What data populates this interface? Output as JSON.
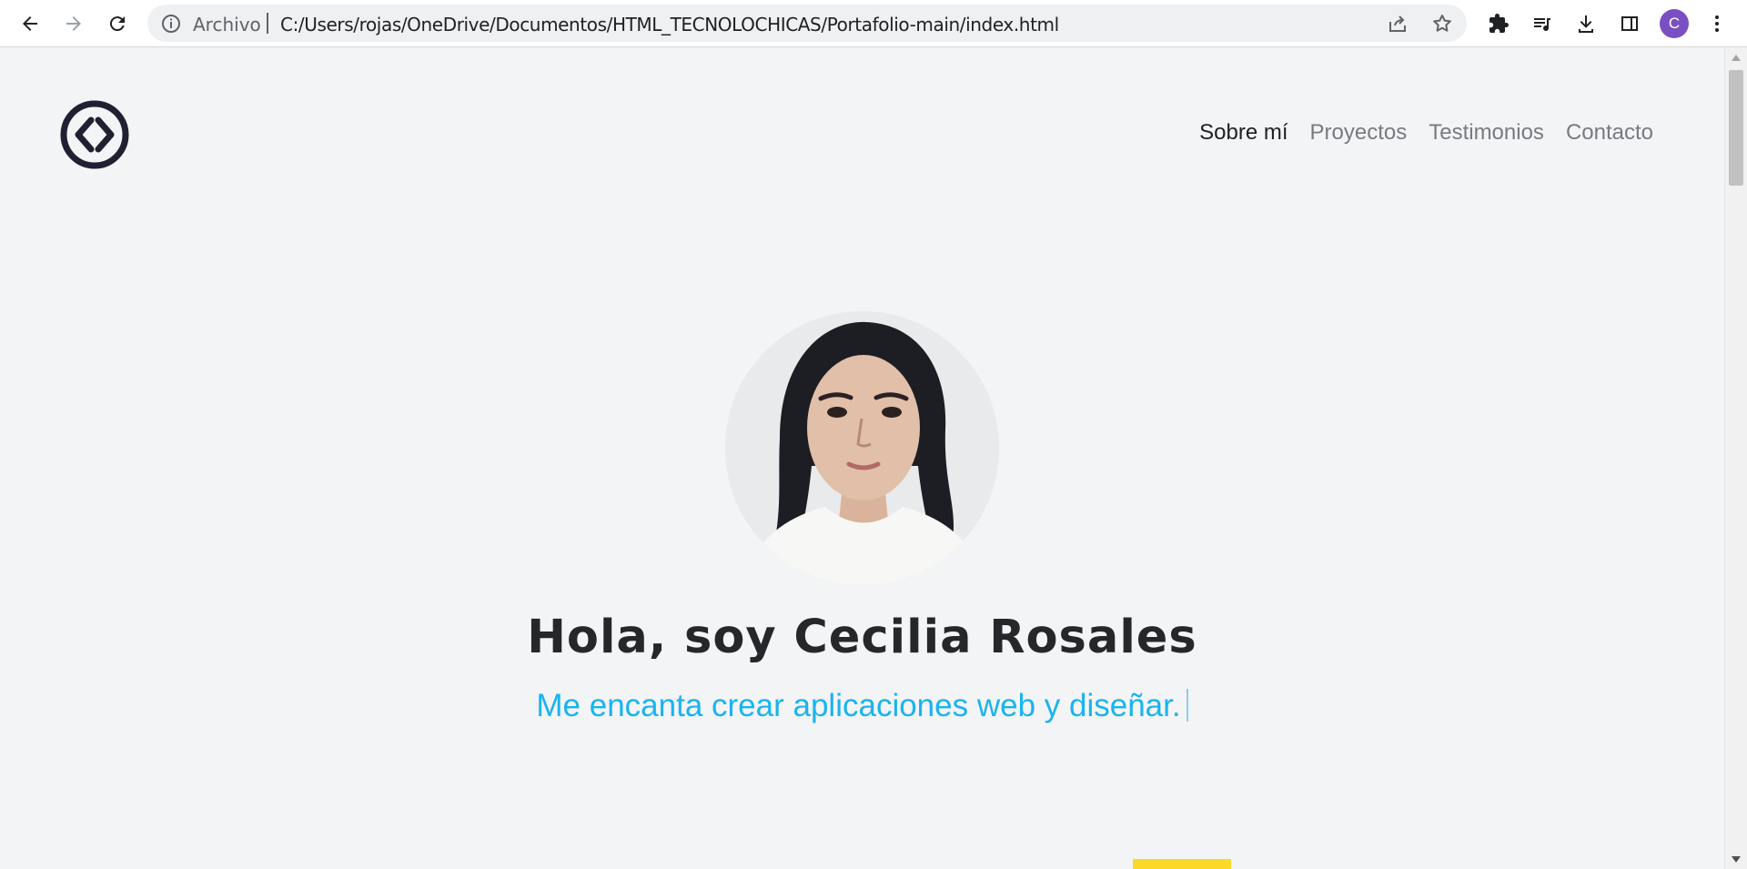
{
  "browser": {
    "url_scheme_label": "Archivo",
    "url": "C:/Users/rojas/OneDrive/Documentos/HTML_TECNOLOCHICAS/Portafolio-main/index.html",
    "profile_initial": "C"
  },
  "nav": {
    "items": [
      {
        "label": "Sobre mí",
        "active": true
      },
      {
        "label": "Proyectos",
        "active": false
      },
      {
        "label": "Testimonios",
        "active": false
      },
      {
        "label": "Contacto",
        "active": false
      }
    ]
  },
  "hero": {
    "title": "Hola, soy Cecilia Rosales",
    "subtitle": "Me encanta crear aplicaciones web y diseñar."
  },
  "colors": {
    "accent": "#19b4ef",
    "highlight": "#fbd928",
    "page_bg": "#f3f4f6",
    "avatar": "#7b4fc4"
  },
  "icons": [
    "back-icon",
    "forward-icon",
    "reload-icon",
    "info-icon",
    "share-icon",
    "star-icon",
    "extensions-icon",
    "media-queue-icon",
    "download-icon",
    "side-panel-icon",
    "kebab-menu-icon",
    "code-logo-icon"
  ]
}
